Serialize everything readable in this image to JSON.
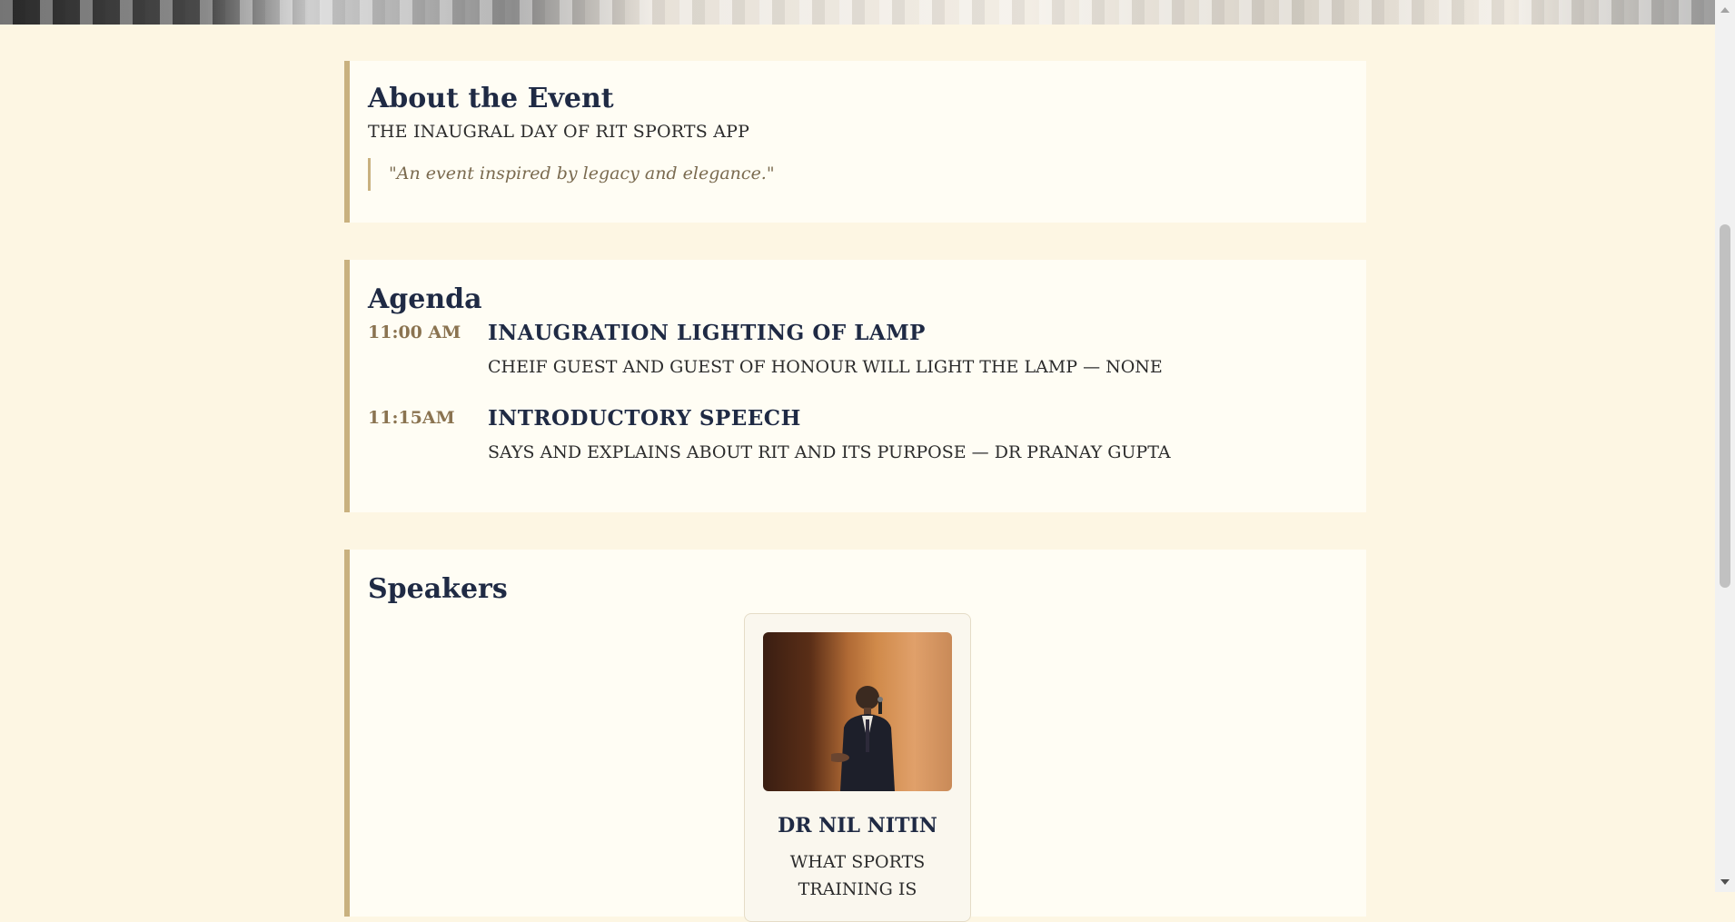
{
  "about": {
    "heading": "About the Event",
    "subtitle": "THE INAUGRAL DAY OF RIT SPORTS APP",
    "quote": "\"An event inspired by legacy and elegance.\""
  },
  "agenda": {
    "heading": "Agenda",
    "items": [
      {
        "time": "11:00 AM",
        "title": "INAUGRATION LIGHTING OF LAMP",
        "description": "CHEIF GUEST AND GUEST OF HONOUR WILL LIGHT THE LAMP — NONE"
      },
      {
        "time": "11:15AM",
        "title": "INTRODUCTORY SPEECH",
        "description": "SAYS AND EXPLAINS ABOUT RIT AND ITS PURPOSE — DR PRANAY GUPTA"
      }
    ]
  },
  "speakers": {
    "heading": "Speakers",
    "items": [
      {
        "name": "DR NIL NITIN",
        "topic": "WHAT SPORTS TRAINING IS"
      }
    ]
  }
}
